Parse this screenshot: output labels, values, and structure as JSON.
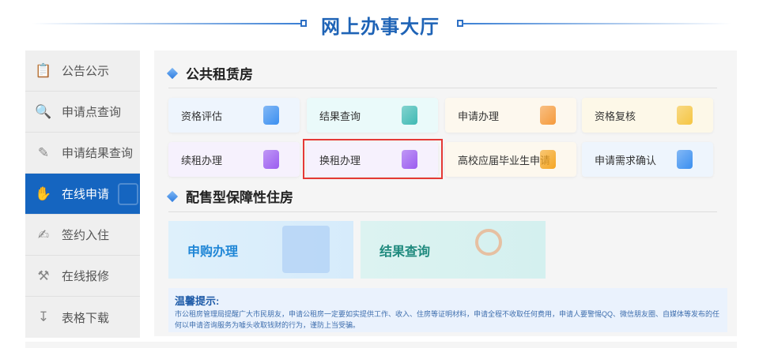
{
  "header": {
    "title": "网上办事大厅"
  },
  "sidebar": {
    "items": [
      {
        "label": "公告公示",
        "icon": "clipboard-icon"
      },
      {
        "label": "申请点查询",
        "icon": "search-doc-icon"
      },
      {
        "label": "申请结果查询",
        "icon": "edit-doc-icon"
      },
      {
        "label": "在线申请",
        "icon": "hand-doc-icon",
        "active": true
      },
      {
        "label": "签约入住",
        "icon": "sign-pen-icon"
      },
      {
        "label": "在线报修",
        "icon": "tools-icon"
      },
      {
        "label": "表格下载",
        "icon": "download-icon"
      }
    ]
  },
  "public_rental": {
    "title": "公共租赁房",
    "cards": [
      {
        "label": "资格评估",
        "color": "#3b8ff0",
        "bg": "#eef5fd"
      },
      {
        "label": "结果查询",
        "color": "#3fb9b3",
        "bg": "#eafafa"
      },
      {
        "label": "申请办理",
        "color": "#f59a3c",
        "bg": "#fdf8ee"
      },
      {
        "label": "资格复核",
        "color": "#f5c542",
        "bg": "#fdf8e8"
      },
      {
        "label": "续租办理",
        "color": "#9b5cf0",
        "bg": "#f6f1fd"
      },
      {
        "label": "换租办理",
        "color": "#9b5cf0",
        "bg": "#f6f1fd"
      },
      {
        "label": "高校应届毕业生申请",
        "color": "#f5a623",
        "bg": "#fdf8ee"
      },
      {
        "label": "申请需求确认",
        "color": "#3b8ff0",
        "bg": "#eef5fd"
      }
    ]
  },
  "affordable": {
    "title": "配售型保障性住房",
    "cards": [
      {
        "label": "申购办理",
        "color": "#1f86d6"
      },
      {
        "label": "结果查询",
        "color": "#1f8a7e"
      }
    ]
  },
  "notice": {
    "title": "温馨提示:",
    "body": "市公租房管理局提醒广大市民朋友，申请公租房一定要如实提供工作、收入、住房等证明材料，申请全程不收取任何费用，申请人要警惕QQ、微信朋友圈、自媒体等发布的任何以申请咨询服务为噱头收取钱财的行为，谨防上当受骗。"
  }
}
